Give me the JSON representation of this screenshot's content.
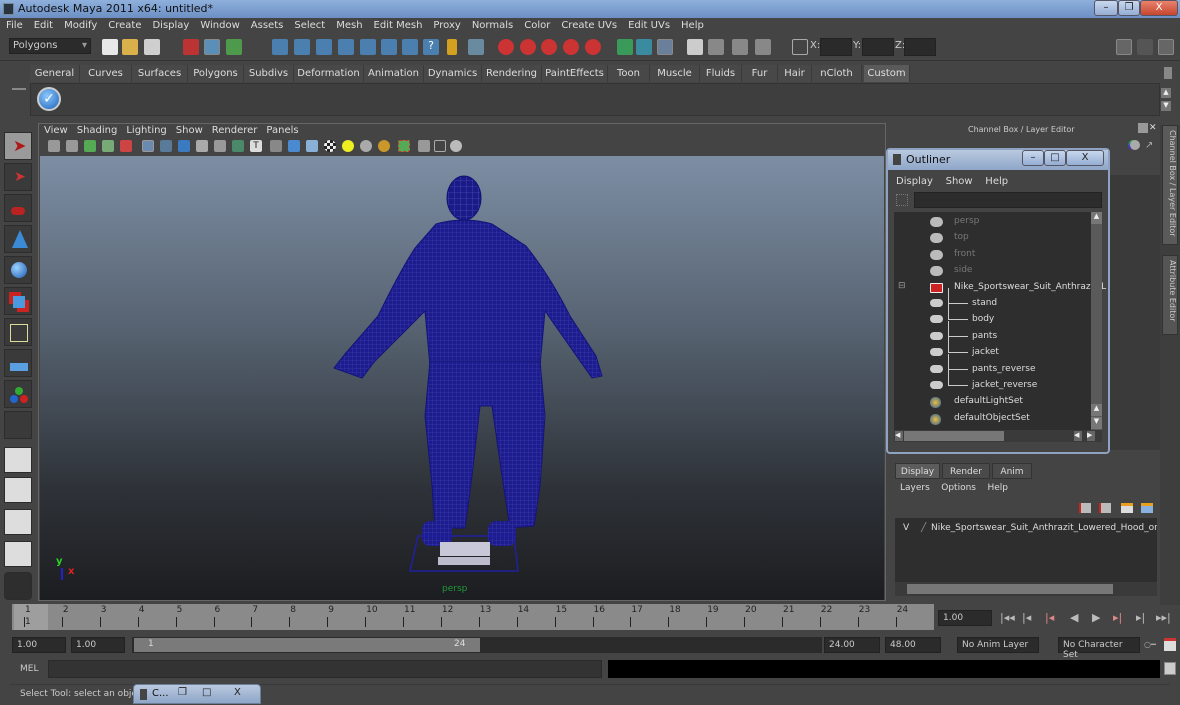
{
  "window": {
    "title": "Autodesk Maya 2011 x64: untitled*",
    "minimize": "–",
    "restore": "❐",
    "close": "X"
  },
  "menubar": [
    "File",
    "Edit",
    "Modify",
    "Create",
    "Display",
    "Window",
    "Assets",
    "Select",
    "Mesh",
    "Edit Mesh",
    "Proxy",
    "Normals",
    "Color",
    "Create UVs",
    "Edit UVs",
    "Help"
  ],
  "toolbar": {
    "menu_set": "Polygons",
    "x_label": "X:",
    "y_label": "Y:",
    "z_label": "Z:",
    "x_value": "",
    "y_value": "",
    "z_value": ""
  },
  "shelf": {
    "tabs": [
      "General",
      "Curves",
      "Surfaces",
      "Polygons",
      "Subdivs",
      "Deformation",
      "Animation",
      "Dynamics",
      "Rendering",
      "PaintEffects",
      "Toon",
      "Muscle",
      "Fluids",
      "Fur",
      "Hair",
      "nCloth",
      "Custom"
    ],
    "active_tab": "Custom"
  },
  "viewport": {
    "menu": [
      "View",
      "Shading",
      "Lighting",
      "Show",
      "Renderer",
      "Panels"
    ],
    "camera_label": "persp",
    "axis": {
      "y": "y",
      "x": "x"
    },
    "colors": {
      "wireframe": "#1a1a8c",
      "camera_label": "#1f9a3a"
    }
  },
  "channel_box": {
    "header": "Channel Box / Layer Editor"
  },
  "side_tabs": [
    "Channel Box / Layer Editor",
    "Attribute Editor"
  ],
  "outliner": {
    "title": "Outliner",
    "menu": [
      "Display",
      "Show",
      "Help"
    ],
    "filter_value": "",
    "items": [
      {
        "label": "persp",
        "type": "camera",
        "dim": true,
        "indent": 0
      },
      {
        "label": "top",
        "type": "camera",
        "dim": true,
        "indent": 0
      },
      {
        "label": "front",
        "type": "camera",
        "dim": true,
        "indent": 0
      },
      {
        "label": "side",
        "type": "camera",
        "dim": true,
        "indent": 0
      },
      {
        "label": "Nike_Sportswear_Suit_Anthrazit_L",
        "type": "group",
        "dim": false,
        "indent": 0,
        "expanded": true
      },
      {
        "label": "stand",
        "type": "mesh",
        "dim": false,
        "indent": 1
      },
      {
        "label": "body",
        "type": "mesh",
        "dim": false,
        "indent": 1
      },
      {
        "label": "pants",
        "type": "mesh",
        "dim": false,
        "indent": 1
      },
      {
        "label": "jacket",
        "type": "mesh",
        "dim": false,
        "indent": 1
      },
      {
        "label": "pants_reverse",
        "type": "mesh",
        "dim": false,
        "indent": 1
      },
      {
        "label": "jacket_reverse",
        "type": "mesh",
        "dim": false,
        "indent": 1
      },
      {
        "label": "defaultLightSet",
        "type": "set",
        "dim": false,
        "indent": 0
      },
      {
        "label": "defaultObjectSet",
        "type": "set",
        "dim": false,
        "indent": 0
      }
    ]
  },
  "layer_editor": {
    "tabs": [
      "Display",
      "Render",
      "Anim"
    ],
    "active_tab": "Display",
    "menu": [
      "Layers",
      "Options",
      "Help"
    ],
    "layers": [
      {
        "visible": "V",
        "name": "Nike_Sportswear_Suit_Anthrazit_Lowered_Hood_on_Ma"
      }
    ]
  },
  "timeline": {
    "ticks": [
      "1",
      "2",
      "3",
      "4",
      "5",
      "6",
      "7",
      "8",
      "9",
      "10",
      "11",
      "12",
      "13",
      "14",
      "15",
      "16",
      "17",
      "18",
      "19",
      "20",
      "21",
      "22",
      "23",
      "24"
    ],
    "current_frame_marker": "1",
    "current_time": "1.00"
  },
  "range": {
    "start": "1.00",
    "playback_start": "1.00",
    "slider_start": "1",
    "slider_end": "24",
    "playback_end": "24.00",
    "end": "48.00",
    "anim_layer": "No Anim Layer",
    "character_set": "No Character Set"
  },
  "command_line": {
    "label": "MEL",
    "value": "",
    "result": ""
  },
  "help_line": {
    "text": "Select Tool: select an object"
  },
  "minimized_window": {
    "title": "C..."
  }
}
